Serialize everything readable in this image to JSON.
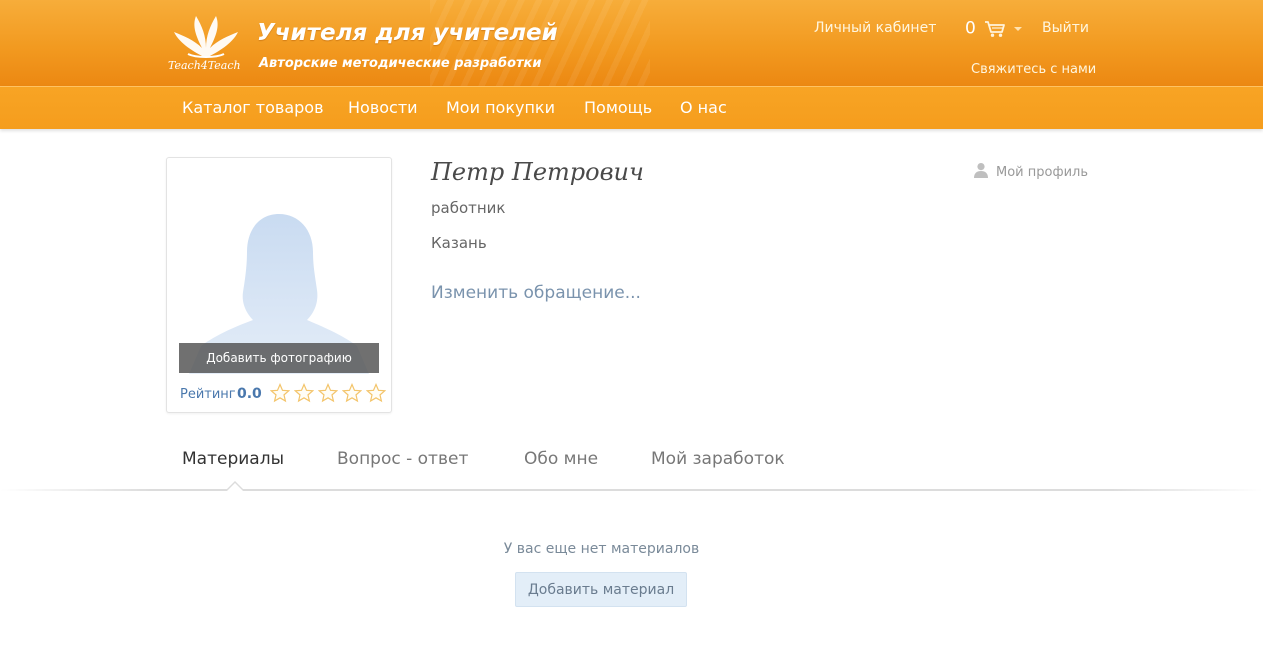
{
  "header": {
    "logo_text": "Teach4Teach",
    "title": "Учителя для учителей",
    "subtitle": "Авторские методические разработки",
    "account_link": "Личный кабинет",
    "cart_count": "0",
    "logout_link": "Выйти",
    "contact_link": "Свяжитесь с нами"
  },
  "nav": {
    "items": [
      {
        "label": "Каталог товаров"
      },
      {
        "label": "Новости"
      },
      {
        "label": "Мои покупки"
      },
      {
        "label": "Помощь"
      },
      {
        "label": "О нас"
      }
    ]
  },
  "profile": {
    "name": "Петр Петрович",
    "position": "работник",
    "city": "Казань",
    "change_address_link": "Изменить обращение...",
    "my_profile_link": "Мой профиль",
    "add_photo_label": "Добавить фотографию",
    "rating_label": "Рейтинг",
    "rating_value": "0.0",
    "rating_stars_filled": 0,
    "rating_stars_total": 5
  },
  "tabs": [
    {
      "label": "Материалы",
      "active": true
    },
    {
      "label": "Вопрос - ответ",
      "active": false
    },
    {
      "label": "Обо мне",
      "active": false
    },
    {
      "label": "Мой заработок",
      "active": false
    }
  ],
  "materials": {
    "empty_message": "У вас еще нет материалов",
    "add_button": "Добавить материал"
  },
  "colors": {
    "header_orange": "#f29a20",
    "nav_orange": "#f59d1d",
    "link_blue": "#4a78ad",
    "star_outline": "#f3c46a"
  }
}
